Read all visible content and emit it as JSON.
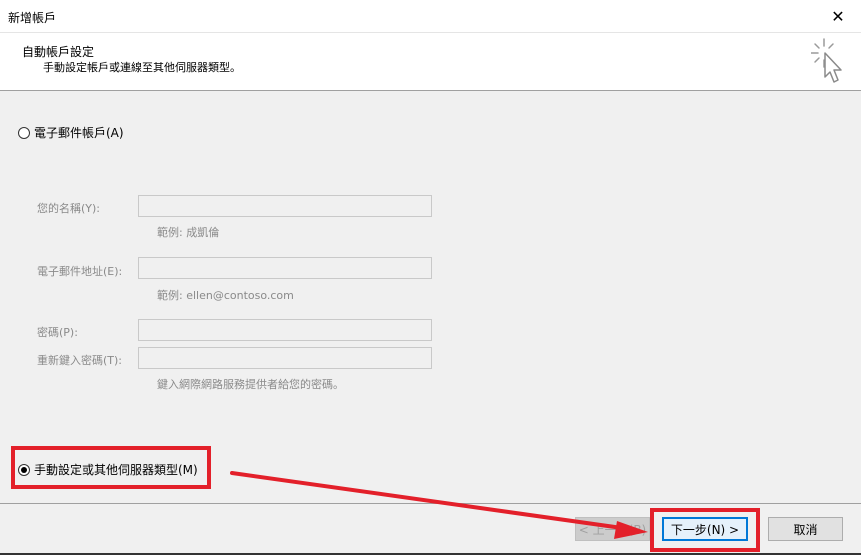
{
  "window": {
    "title": "新增帳戶",
    "close_glyph": "✕"
  },
  "header": {
    "title": "自動帳戶設定",
    "subtitle": "手動設定帳戶或連線至其他伺服器類型。",
    "icon": "setup-wizard-cursor-icon"
  },
  "options": {
    "email_account": {
      "label": "電子郵件帳戶(A)",
      "selected": false
    },
    "manual": {
      "label": "手動設定或其他伺服器類型(M)",
      "selected": true
    }
  },
  "form": {
    "name": {
      "label": "您的名稱(Y):",
      "value": "",
      "hint": "範例: 成凱倫"
    },
    "email": {
      "label": "電子郵件地址(E):",
      "value": "",
      "hint": "範例: ellen@contoso.com"
    },
    "password": {
      "label": "密碼(P):",
      "value": ""
    },
    "retype_password": {
      "label": "重新鍵入密碼(T):",
      "value": "",
      "hint": "鍵入網際網路服務提供者給您的密碼。"
    }
  },
  "buttons": {
    "back": "< 上一步(B)",
    "next": "下一步(N) >",
    "cancel": "取消"
  },
  "annotation": {
    "highlight_color": "#e3202a"
  }
}
